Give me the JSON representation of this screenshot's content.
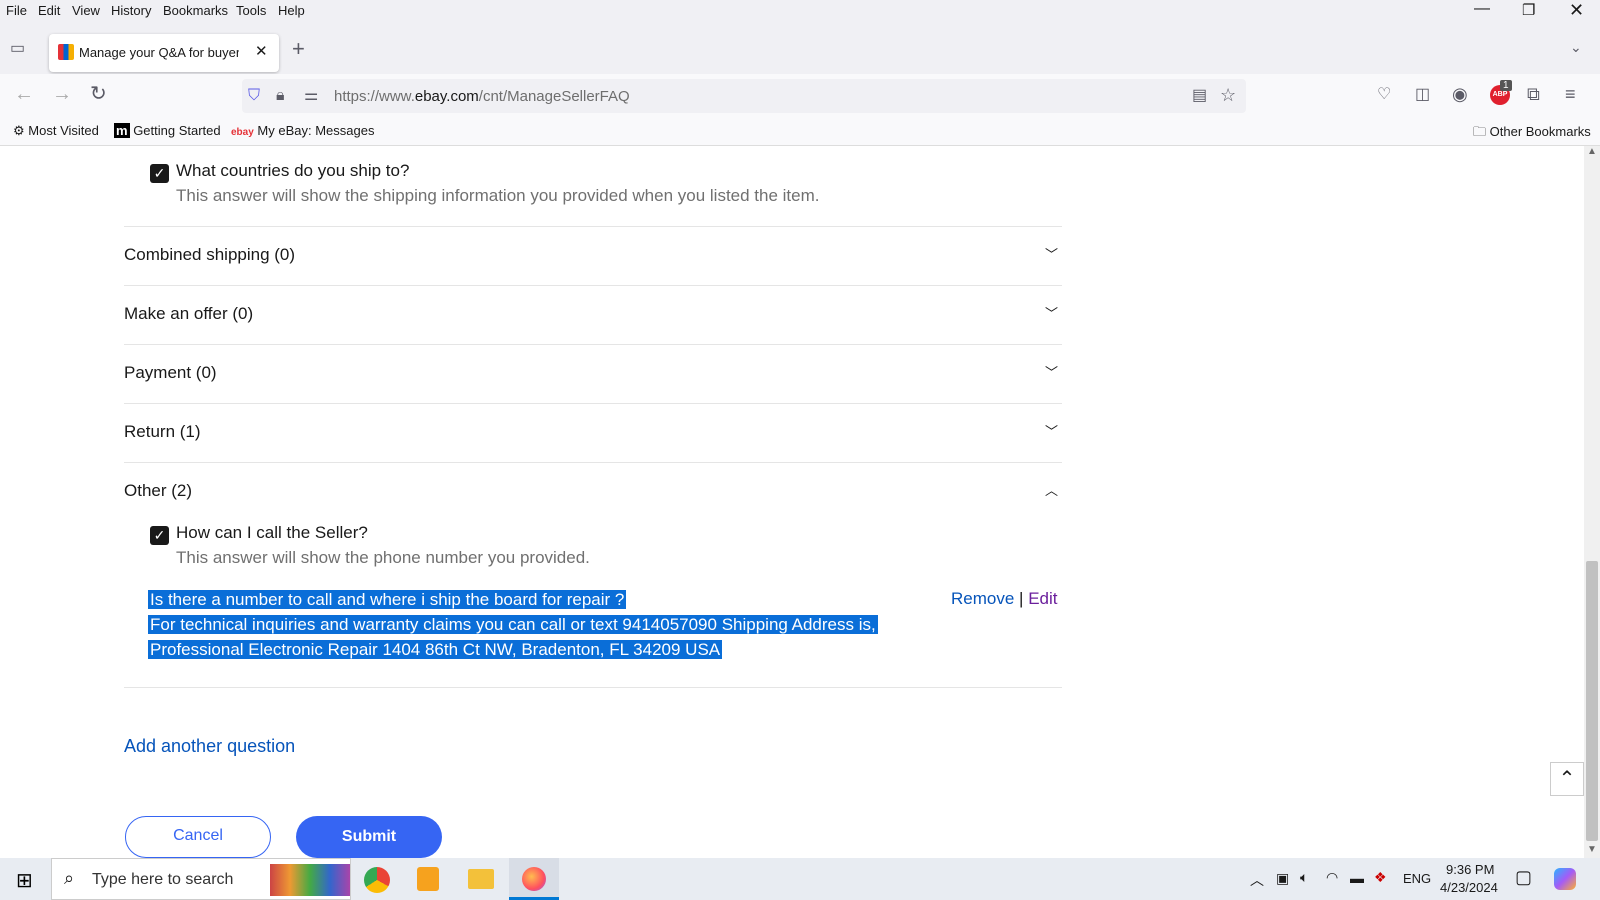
{
  "menu": [
    "File",
    "Edit",
    "View",
    "History",
    "Bookmarks",
    "Tools",
    "Help"
  ],
  "tab": {
    "title": "Manage your Q&A for buyers | eBay"
  },
  "url": {
    "prefix": "https://www.",
    "domain": "ebay.com",
    "path": "/cnt/ManageSellerFAQ"
  },
  "extensions": {
    "abp_badge": "1",
    "abp_label": "ABP"
  },
  "bookmarks": [
    "Most Visited",
    "Getting Started",
    "My eBay: Messages"
  ],
  "other_bookmarks": "Other Bookmarks",
  "page": {
    "shipping_question": {
      "title": "What countries do you ship to?",
      "desc": "This answer will show the shipping information you provided when you listed the item.",
      "checked": true
    },
    "sections": [
      {
        "label": "Combined shipping (0)",
        "expanded": false
      },
      {
        "label": "Make an offer (0)",
        "expanded": false
      },
      {
        "label": "Payment (0)",
        "expanded": false
      },
      {
        "label": "Return (1)",
        "expanded": false
      },
      {
        "label": "Other (2)",
        "expanded": true
      }
    ],
    "other_question": {
      "title": "How can I call the Seller?",
      "desc": "This answer will show the phone number you provided.",
      "checked": true
    },
    "custom_qa": {
      "question": "Is there a number to call and where i ship the board for repair ?",
      "answer_line1": "For technical inquiries and warranty claims you can call or text 9414057090 Shipping Address is,",
      "answer_line2": "Professional Electronic Repair 1404 86th Ct NW, Bradenton, FL 34209 USA",
      "remove": "Remove",
      "sep": "|",
      "edit": "Edit"
    },
    "add_question": "Add another question",
    "cancel": "Cancel",
    "submit": "Submit"
  },
  "taskbar": {
    "search_placeholder": "Type here to search",
    "lang": "ENG",
    "time": "9:36 PM",
    "date": "4/23/2024"
  },
  "colors": {
    "accent": "#3665f3",
    "link": "#0654ba",
    "edit_link": "#6b1f9c",
    "selection": "#0a6ed8"
  }
}
